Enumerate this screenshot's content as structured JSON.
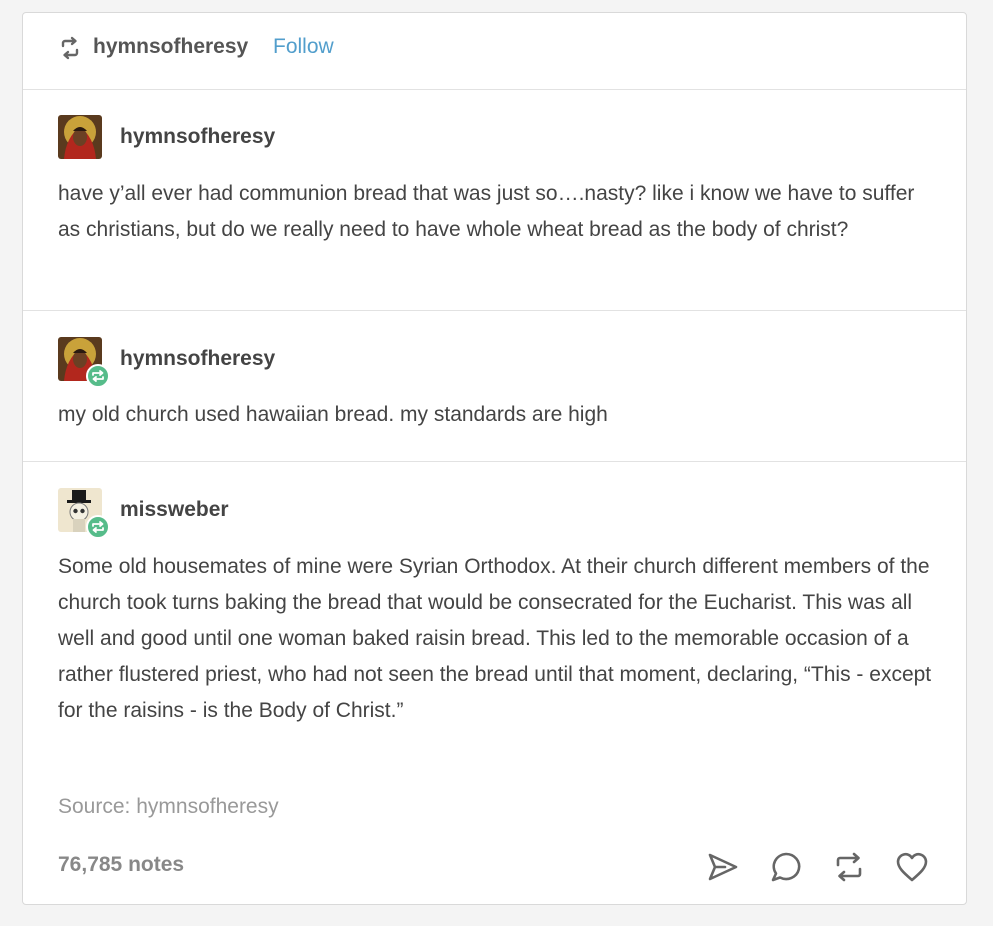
{
  "header": {
    "blog_name": "hymnsofheresy",
    "follow_label": "Follow",
    "icon": "reblog-icon"
  },
  "posts": [
    {
      "author": "hymnsofheresy",
      "avatar": "icon-painting-avatar",
      "reblog_badge": false,
      "text": "have y’all ever had communion bread that was just so….nasty? like i know we have to suffer as christians, but do we really need to have whole wheat bread as the body of christ?"
    },
    {
      "author": "hymnsofheresy",
      "avatar": "icon-painting-avatar",
      "reblog_badge": true,
      "text": "my old church used hawaiian bread. my standards are high"
    },
    {
      "author": "missweber",
      "avatar": "skeleton-top-hat-avatar",
      "reblog_badge": true,
      "text": "Some old housemates of mine were Syrian Orthodox. At their church different members of the church took turns baking the bread that would be consecrated for the Eucharist. This was all well and good until one woman baked raisin bread. This led to the memorable occasion of a rather flustered priest, who had not seen the bread until that moment, declaring, “This - except for the raisins - is the Body of Christ.”"
    }
  ],
  "footer": {
    "source_prefix": "Source:",
    "source_name": "hymnsofheresy",
    "notes": "76,785 notes",
    "actions": [
      "share-icon",
      "reply-icon",
      "reblog-icon",
      "like-icon"
    ]
  },
  "colors": {
    "follow": "#529ecc",
    "badge": "#56bc8a",
    "text": "#444444",
    "muted": "#999999"
  }
}
